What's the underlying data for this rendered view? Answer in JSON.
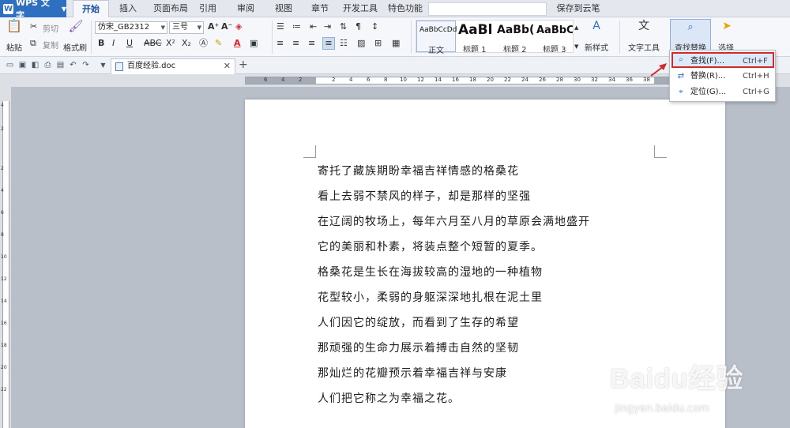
{
  "app": {
    "name": "WPS 文字"
  },
  "menu_tabs": [
    "开始",
    "插入",
    "页面布局",
    "引用",
    "审阅",
    "视图",
    "章节",
    "开发工具",
    "特色功能"
  ],
  "cloud_save": "保存到云笔记",
  "ribbon": {
    "paste": "粘贴",
    "cut": "剪切",
    "copy": "复制",
    "format_painter": "格式刷",
    "font_name": "仿宋_GB2312",
    "font_size": "三号",
    "styles": [
      {
        "preview": "AaBbCcDd",
        "label": "正文"
      },
      {
        "preview": "AaBl",
        "label": "标题 1"
      },
      {
        "preview": "AaBb(",
        "label": "标题 2"
      },
      {
        "preview": "AaBbC",
        "label": "标题 3"
      }
    ],
    "new_style": "新样式",
    "text_tools": "文字工具",
    "find_replace": "查找替换",
    "select": "选择"
  },
  "document": {
    "tab_name": "百度经验.doc",
    "lines": [
      "寄托了藏族期盼幸福吉祥情感的格桑花",
      "看上去弱不禁风的样子，却是那样的坚强",
      "在辽阔的牧场上，每年六月至八月的草原会满地盛开",
      "它的美丽和朴素，将装点整个短暂的夏季。",
      "格桑花是生长在海拔较高的湿地的一种植物",
      "花型较小，柔弱的身躯深深地扎根在泥土里",
      "人们因它的绽放，而看到了生存的希望",
      "那顽强的生命力展示着搏击自然的坚韧",
      "那灿烂的花瓣预示着幸福吉祥与安康",
      "人们把它称之为幸福之花。"
    ]
  },
  "dropdown": {
    "items": [
      {
        "label": "查找(F)...",
        "shortcut": "Ctrl+F"
      },
      {
        "label": "替换(R)...",
        "shortcut": "Ctrl+H"
      },
      {
        "label": "定位(G)...",
        "shortcut": "Ctrl+G"
      }
    ]
  },
  "ruler_h": [
    "6",
    "4",
    "2",
    "2",
    "4",
    "6",
    "8",
    "10",
    "12",
    "14",
    "16",
    "18",
    "20",
    "22",
    "24",
    "26",
    "28",
    "30",
    "32",
    "34",
    "36",
    "38"
  ],
  "ruler_v": [
    "4",
    "2",
    "2",
    "4",
    "6",
    "8",
    "10",
    "12",
    "14",
    "16",
    "18",
    "20",
    "22"
  ],
  "watermark": {
    "text": "Baidu经验",
    "sub": "jingyan.baidu.com"
  },
  "colors": {
    "accent": "#2f6fc0",
    "highlight_border": "#d12a2a",
    "arrow": "#d12a2a"
  }
}
